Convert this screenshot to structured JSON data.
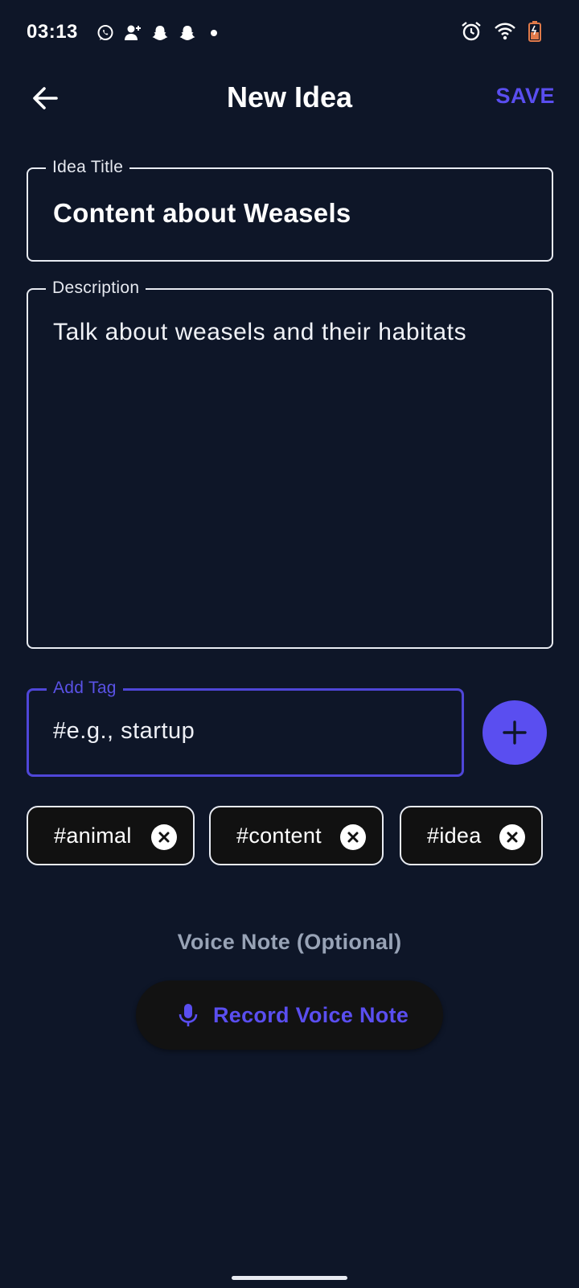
{
  "status_bar": {
    "time": "03:13",
    "left_icons": [
      "whatsapp-icon",
      "person-add-icon",
      "snapchat-icon",
      "snapchat-icon"
    ],
    "right_icons": [
      "alarm-icon",
      "wifi-icon",
      "battery-icon"
    ]
  },
  "app_bar": {
    "title": "New Idea",
    "save_label": "SAVE",
    "back_icon": "arrow-left-icon"
  },
  "form": {
    "title_label": "Idea Title",
    "title_value": "Content about Weasels",
    "description_label": "Description",
    "description_value": "Talk about weasels and their habitats",
    "tag_label": "Add Tag",
    "tag_placeholder": "#e.g., startup"
  },
  "tags": [
    {
      "label": "#animal"
    },
    {
      "label": "#content"
    },
    {
      "label": "#idea"
    }
  ],
  "voice": {
    "section_label": "Voice Note (Optional)",
    "record_label": "Record Voice Note",
    "record_icon": "microphone-icon"
  },
  "colors": {
    "background": "#0e1628",
    "accent": "#5a4ef0",
    "focused_outline": "#4f46d8",
    "muted_text": "#98a3b6",
    "chip_background": "#111111"
  }
}
